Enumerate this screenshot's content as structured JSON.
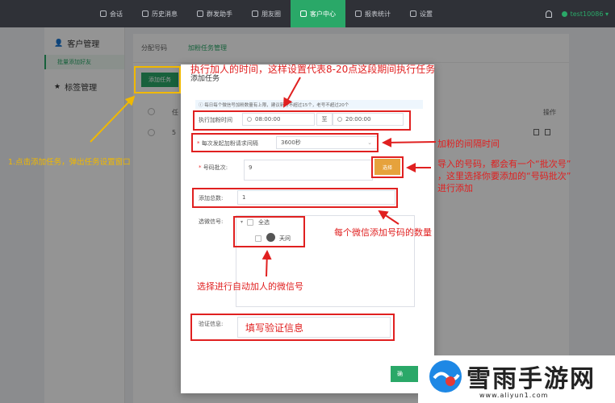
{
  "nav": {
    "items": [
      {
        "label": "会话",
        "active": false
      },
      {
        "label": "历史消息",
        "active": false
      },
      {
        "label": "群发助手",
        "active": false
      },
      {
        "label": "朋友圈",
        "active": false
      },
      {
        "label": "客户中心",
        "active": true
      },
      {
        "label": "报表统计",
        "active": false
      },
      {
        "label": "设置",
        "active": false
      }
    ],
    "user": "test10086"
  },
  "sidebar": {
    "group1": "客户管理",
    "sub1": "批量添加好友",
    "group2": "标签管理"
  },
  "content": {
    "tabs": [
      "分配号码",
      "加粉任务管理"
    ],
    "add_task": "添加任务",
    "col_task": "任",
    "col_ops": "操作",
    "row_no": "5"
  },
  "modal": {
    "title": "添加任务",
    "info": "ⓘ 每日每个微信号加粉数量有上限，建议新号不超过15个，老号不超过20个",
    "exec_time_label": "执行加粉时间",
    "start_time": "08:00:00",
    "to": "至",
    "end_time": "20:00:00",
    "interval_label": "每次发起加粉请求间隔",
    "interval_value": "3600秒",
    "batch_label": "号码批次:",
    "batch_value": "9",
    "choose_btn": "选择",
    "total_label": "添加总数:",
    "total_value": "1",
    "wx_label": "选微信号:",
    "select_all": "全选",
    "account": "天问",
    "verify_label": "验证信息:",
    "verify_value": "填写验证信息",
    "confirm": "确"
  },
  "annotations": {
    "exec_time": "执行加人的时间，这样设置代表8-20点这段期间执行任务",
    "interval": "加粉的间隔时间",
    "batch_line1": "导入的号码，都会有一个“批次号”",
    "batch_line2": "，这里选择你要添加的“号码批次”",
    "batch_line3": "进行添加",
    "total": "每个微信添加号码的数量",
    "wx": "选择进行自动加人的微信号",
    "step1": "1.点击添加任务，弹出任务设置窗口"
  },
  "watermark": {
    "name": "雪雨手游网",
    "url": "www.aliyun1.com"
  },
  "colors": {
    "accent": "#2aa868",
    "annotation_red": "#e02020",
    "annotation_yellow": "#f0b800",
    "choose_orange": "#e6a23c",
    "nav_bg": "#2f3137"
  }
}
